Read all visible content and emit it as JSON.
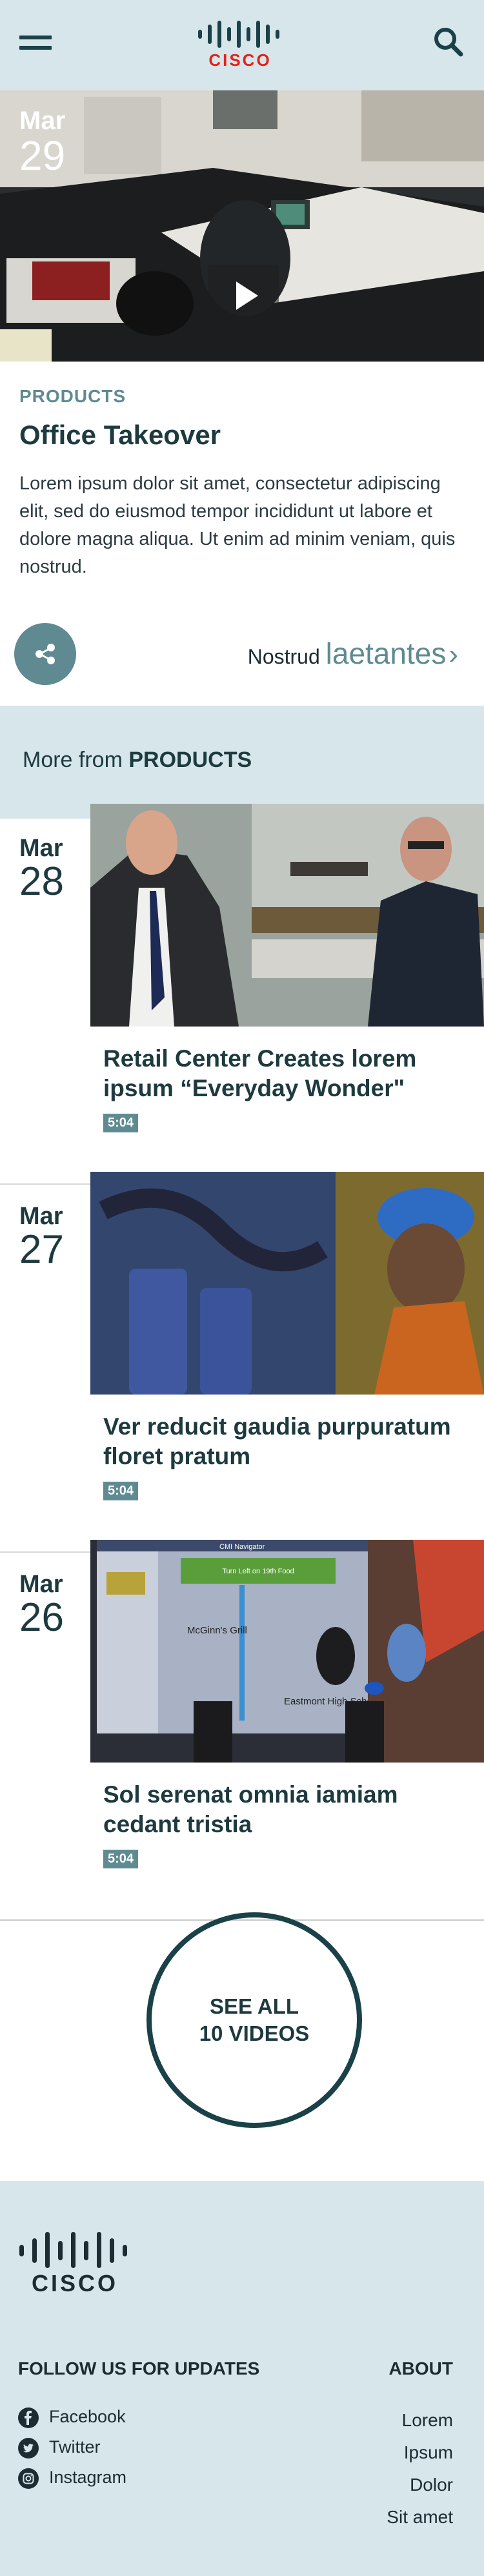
{
  "header": {
    "logo_text": "CISCO"
  },
  "hero": {
    "month": "Mar",
    "day": "29"
  },
  "article": {
    "kicker": "PRODUCTS",
    "title": "Office Takeover",
    "description": "Lorem ipsum dolor sit amet, consectetur adipiscing elit, sed do eiusmod tempor incididunt ut labore et dolore magna aliqua. Ut enim ad minim veniam, quis nostrud.",
    "link_prefix": "Nostrud",
    "link_big": "laetantes",
    "link_chevron": "›"
  },
  "more_from": {
    "prefix": "More from ",
    "category": "PRODUCTS"
  },
  "videos": [
    {
      "month": "Mar",
      "day": "28",
      "title": "Retail Center Creates lorem ipsum “Everyday Wonder\"",
      "duration": "5:04"
    },
    {
      "month": "Mar",
      "day": "27",
      "title": "Ver reducit gaudia purpuratum floret pratum",
      "duration": "5:04"
    },
    {
      "month": "Mar",
      "day": "26",
      "title": "Sol serenat omnia iamiam cedant tristia",
      "duration": "5:04"
    }
  ],
  "thumb3_text": {
    "nav_title": "CMI Navigator",
    "banner": "Turn Left on 19th Food",
    "store1": "McGinn's Grill",
    "store2": "Eastmont High School"
  },
  "see_all": {
    "line1": "SEE ALL",
    "line2": "10 VIDEOS"
  },
  "footer": {
    "logo_text": "CISCO",
    "follow_heading": "FOLLOW US FOR UPDATES",
    "about_heading": "ABOUT",
    "social": [
      "Facebook",
      "Twitter",
      "Instagram"
    ],
    "about_links": [
      "Lorem",
      "Ipsum",
      "Dolor",
      "Sit amet"
    ]
  },
  "colors": {
    "band": "#d6e6ea",
    "accent": "#5f8a92",
    "dark": "#1a4148",
    "cisco_red": "#e2231a"
  },
  "icons": [
    "menu-icon",
    "search-icon",
    "play-icon",
    "share-icon",
    "chevron-right-icon",
    "facebook-icon",
    "twitter-icon",
    "instagram-icon"
  ]
}
